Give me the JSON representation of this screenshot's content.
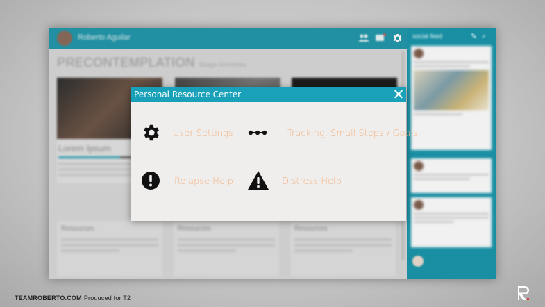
{
  "app": {
    "user_name": "Roberto Aguilar",
    "page_title": "PRECONTEMPLATION",
    "page_subtitle": "Stage Activities",
    "cards": [
      {
        "title": "Lorem Ipsum"
      },
      {
        "title": ""
      },
      {
        "title": ""
      }
    ],
    "resources": [
      {
        "title": "Resources"
      },
      {
        "title": "Resources"
      },
      {
        "title": "Resources"
      }
    ],
    "feed": {
      "title": "social feed"
    },
    "icons": {
      "people": "people-icon",
      "chat": "chat-icon",
      "settings": "gear-icon",
      "edit": "pencil-icon",
      "search": "search-icon"
    }
  },
  "modal": {
    "title": "Personal Resource Center",
    "close_icon": "close-icon",
    "options": [
      {
        "label": "User Settings",
        "icon": "gear-icon"
      },
      {
        "label": "Tracking: Small Steps / Goals",
        "icon": "dots-line-icon"
      },
      {
        "label": "Relapse Help",
        "icon": "exclamation-circle-icon"
      },
      {
        "label": "Distress Help",
        "icon": "warning-triangle-icon"
      }
    ]
  },
  "footer": {
    "brand": "TEAMROBERTO.COM",
    "produced": "Produced for T2"
  },
  "colors": {
    "teal": "#1e97ab",
    "modal_header": "#18a1b8",
    "label_orange": "#f4b07c",
    "modal_bg": "#efeeed"
  }
}
